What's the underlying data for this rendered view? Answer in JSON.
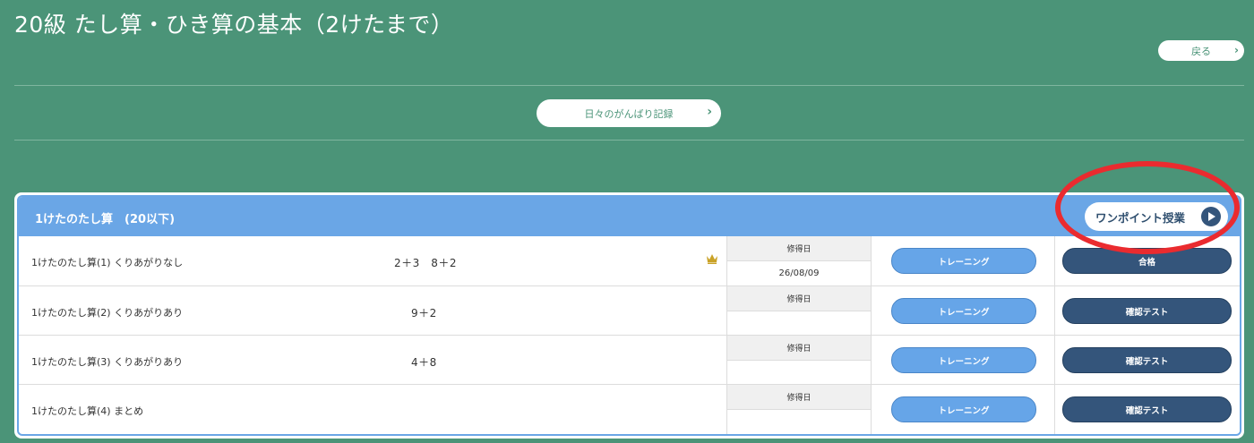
{
  "page": {
    "title": "20級 たし算・ひき算の基本（2けたまで）",
    "back_label": "戻る",
    "record_label": "日々のがんばり記録"
  },
  "unit": {
    "title": "1けたのたし算　(20以下)",
    "onepoint_label": "ワンポイント授業",
    "date_header": "修得日",
    "training_label": "トレーニング",
    "lessons": [
      {
        "name": "1けたのたし算(1) くりあがりなし",
        "example": "2＋3　8＋2",
        "date": "26/08/09",
        "crown": true,
        "test_label": "合格"
      },
      {
        "name": "1けたのたし算(2) くりあがりあり",
        "example": "9＋2",
        "date": "",
        "crown": false,
        "test_label": "確認テスト"
      },
      {
        "name": "1けたのたし算(3) くりあがりあり",
        "example": "4＋8",
        "date": "",
        "crown": false,
        "test_label": "確認テスト"
      },
      {
        "name": "1けたのたし算(4) まとめ",
        "example": "",
        "date": "",
        "crown": false,
        "test_label": "確認テスト"
      }
    ]
  },
  "colors": {
    "background": "#4b9478",
    "header_blue": "#6aa6e6",
    "training_blue": "#66a5e8",
    "test_navy": "#34557b",
    "highlight_red": "#ea2b2f",
    "crown_gold": "#c9a227"
  },
  "icons": {
    "back": "chevron-right-icon",
    "record": "chevron-right-icon",
    "onepoint": "play-icon",
    "mastered": "crown-icon"
  }
}
